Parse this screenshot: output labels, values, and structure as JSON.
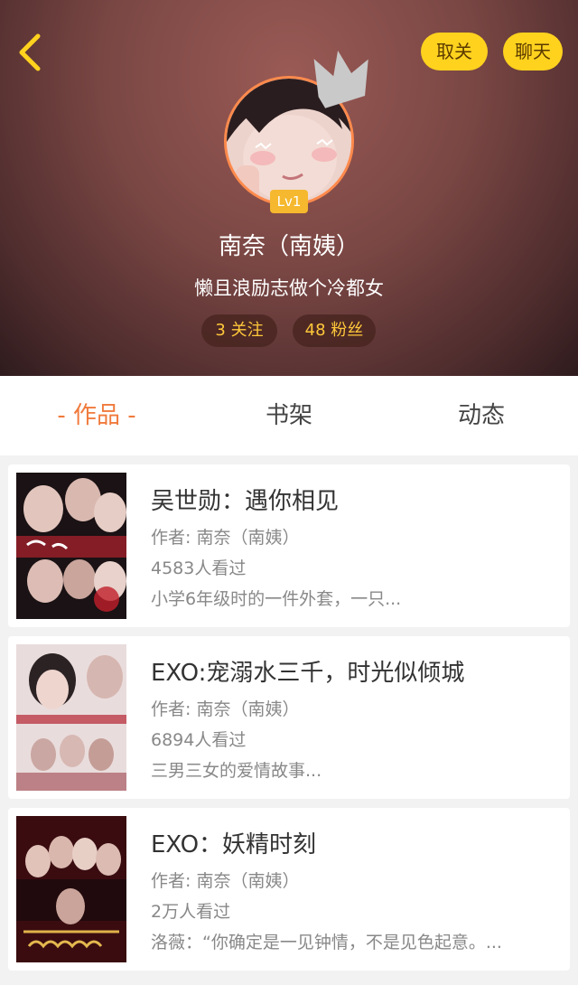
{
  "header": {
    "unfollow_label": "取关",
    "chat_label": "聊天",
    "level": "Lv1",
    "name": "南奈（南姨）",
    "bio": "懒且浪励志做个冷都女",
    "following": "3 关注",
    "fans": "48 粉丝"
  },
  "tabs": {
    "works": "- 作品 -",
    "bookshelf": "书架",
    "feed": "动态"
  },
  "books": [
    {
      "title": "吴世勋：遇你相见",
      "author": "作者: 南奈（南姨）",
      "views": "4583人看过",
      "desc": "小学6年级时的一件外套，一只..."
    },
    {
      "title": "EXO:宠溺水三千，时光似倾城",
      "author": "作者: 南奈（南姨）",
      "views": "6894人看过",
      "desc": "三男三女的爱情故事..."
    },
    {
      "title": "EXO：妖精时刻",
      "author": "作者: 南奈（南姨）",
      "views": "2万人看过",
      "desc": "洛薇：“你确定是一见钟情，不是见色起意。..."
    }
  ]
}
